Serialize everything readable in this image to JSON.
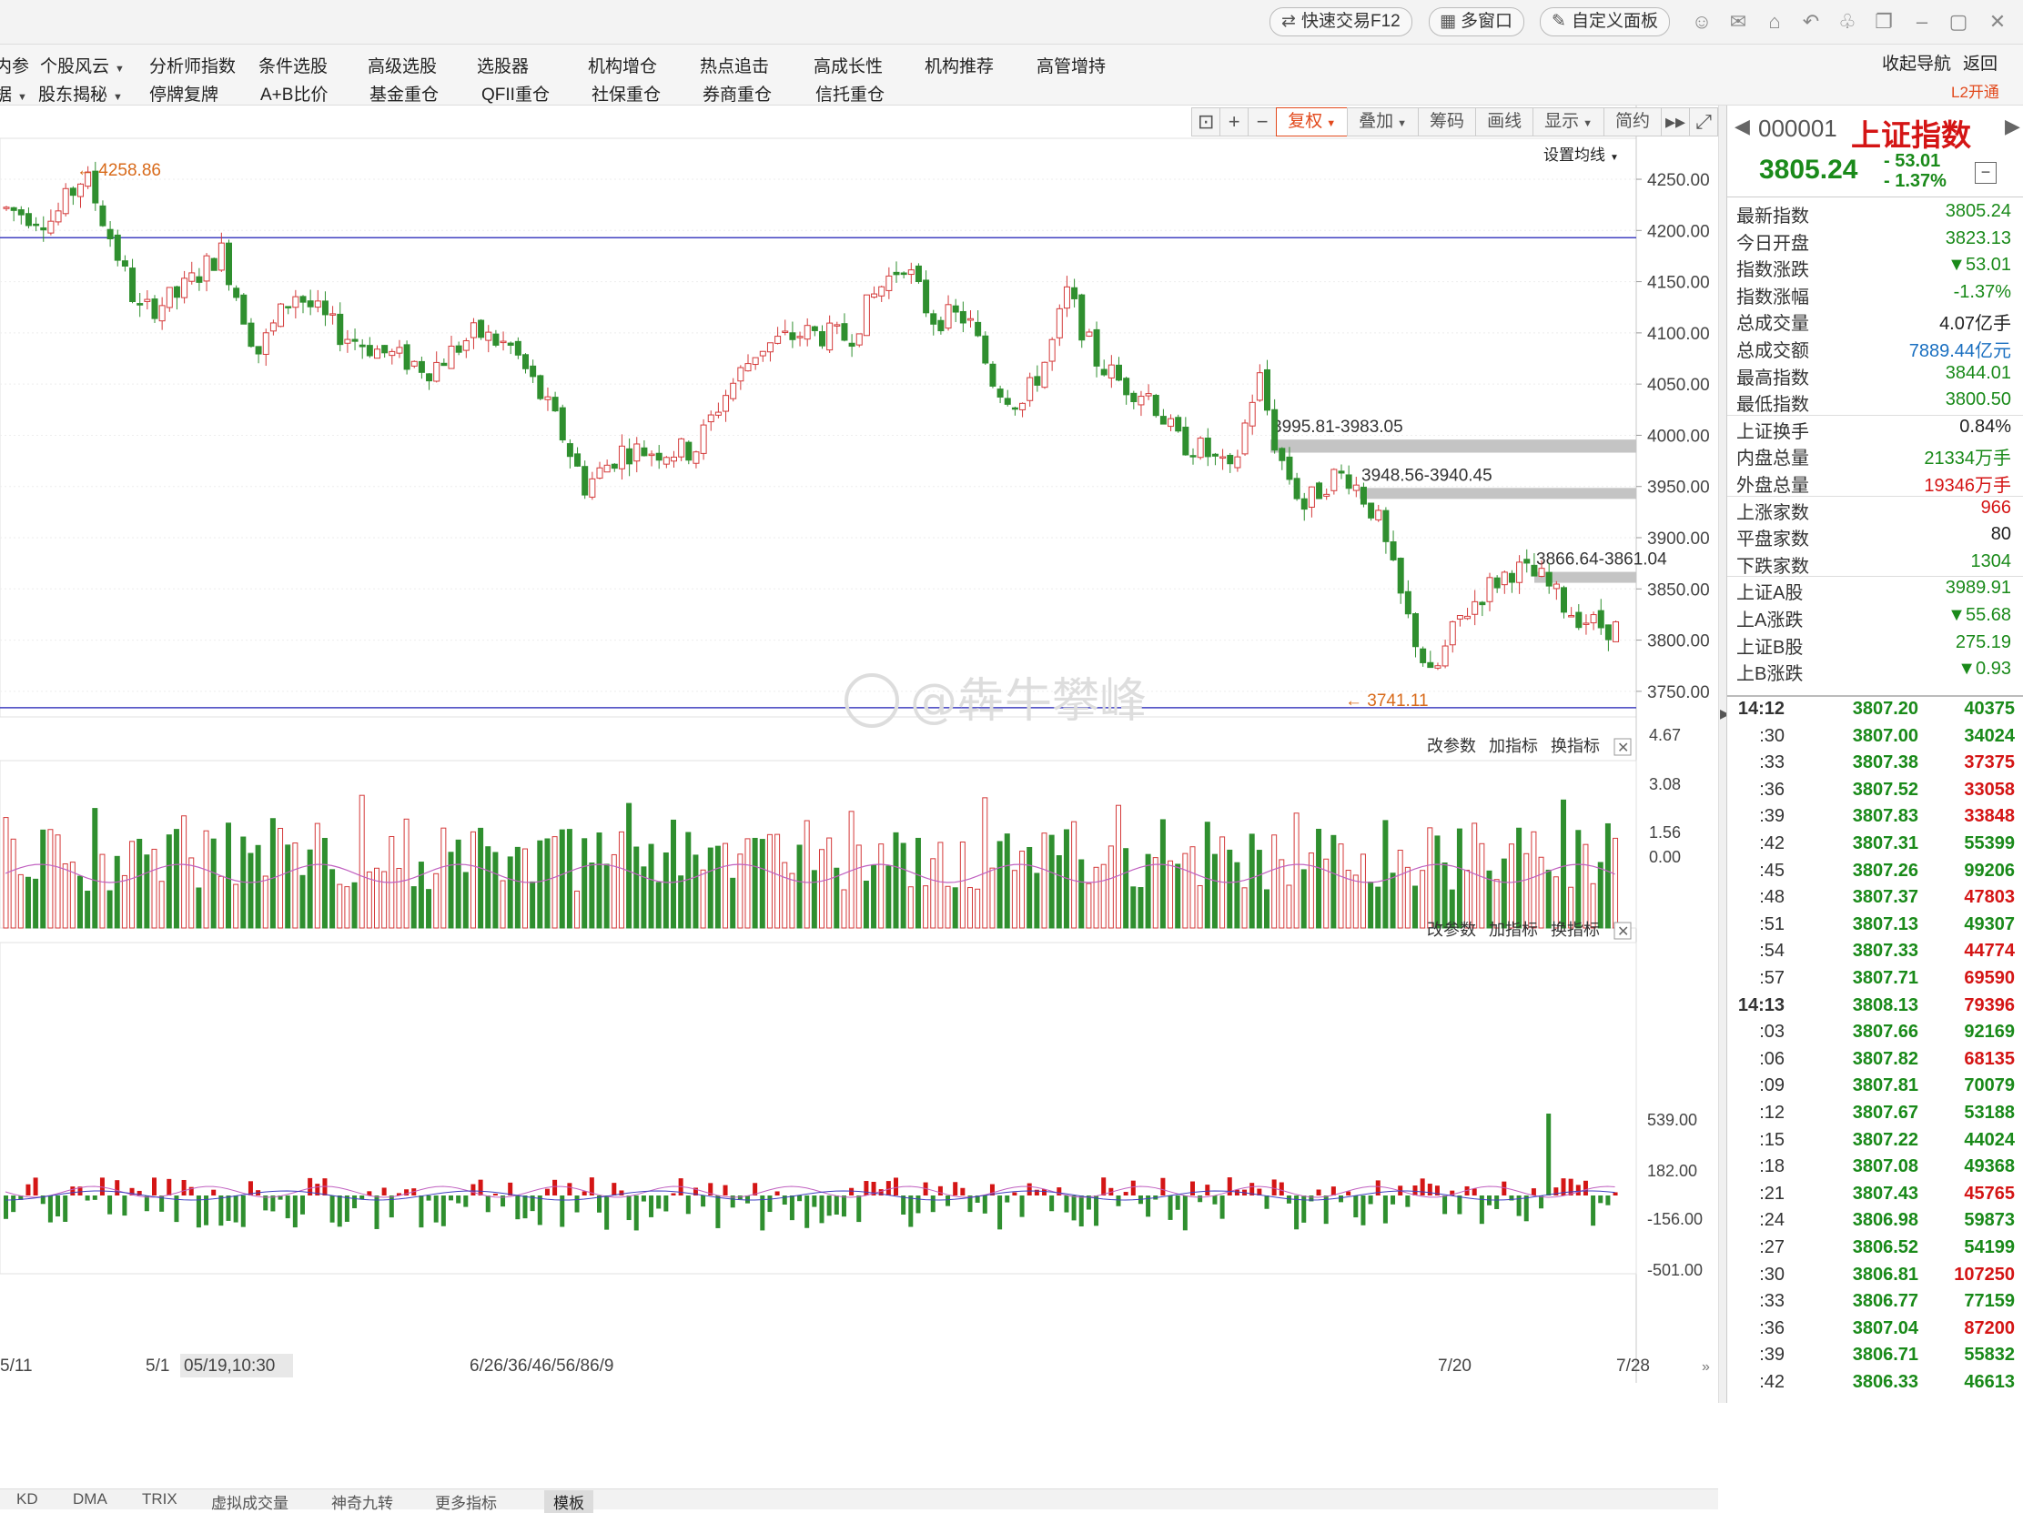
{
  "topbar": {
    "quick_trade": "快速交易F12",
    "multi_window": "多窗口",
    "custom_panel": "自定义面板"
  },
  "menu": {
    "row1": [
      "内参",
      "个股风云",
      "分析师指数",
      "条件选股",
      "高级选股",
      "选股器",
      "机构增仓",
      "热点追击",
      "高成长性",
      "机构推荐",
      "高管增持"
    ],
    "row2": [
      "据",
      "股东揭秘",
      "停牌复牌",
      "A+B比价",
      "基金重仓",
      "QFII重仓",
      "社保重仓",
      "券商重仓",
      "信托重仓"
    ],
    "collapse_nav": "收起导航",
    "back": "返回",
    "l2": "L2开通"
  },
  "toolbar": {
    "fuquan": "复权",
    "overlay": "叠加",
    "chips": "筹码",
    "draw": "画线",
    "display": "显示",
    "simple": "简约"
  },
  "chart": {
    "avg_setting": "设置均线",
    "y_ticks": [
      "4250.00",
      "4200.00",
      "4150.00",
      "4100.00",
      "4050.00",
      "4000.00",
      "3950.00",
      "3900.00",
      "3850.00",
      "3800.00",
      "3750.00"
    ],
    "high_label": "4258.86",
    "low_label": "3741.11",
    "gaps": [
      "3995.81-3983.05",
      "3948.56-3940.45",
      "3866.64-3861.04"
    ],
    "watermark": "@犇牛攀峰",
    "vol_ticks": [
      "4.67",
      "3.08",
      "1.56",
      "0.00"
    ],
    "sub_ticks": [
      "539.00",
      "182.00",
      "-156.00",
      "-501.00"
    ],
    "subpanel_actions": [
      "改参数",
      "加指标",
      "换指标"
    ],
    "x_labels": [
      "5/11",
      "5/1",
      "05/19,10:30",
      "6/26/36/46/56/86/9",
      "7/20",
      "7/28"
    ]
  },
  "chart_data": {
    "type": "candlestick",
    "ylim": [
      3725,
      4290
    ],
    "annotations": {
      "high": 4258.86,
      "low": 3741.11
    },
    "horizontal_lines": [
      4193,
      3734
    ],
    "gaps": [
      [
        3983.05,
        3995.81
      ],
      [
        3940.45,
        3948.56
      ],
      [
        3861.04,
        3866.64
      ]
    ]
  },
  "bottom_tabs": [
    "KD",
    "DMA",
    "TRIX",
    "虚拟成交量",
    "神奇九转",
    "更多指标",
    "模板"
  ],
  "quote": {
    "code": "000001",
    "name": "上证指数",
    "price": "3805.24",
    "change": "- 53.01",
    "change_pct": "- 1.37%",
    "fields": [
      {
        "k": "最新指数",
        "v": "3805.24",
        "c": "#1a8a1a"
      },
      {
        "k": "今日开盘",
        "v": "3823.13",
        "c": "#1a8a1a"
      },
      {
        "k": "指数涨跌",
        "v": "▼53.01",
        "c": "#1a8a1a"
      },
      {
        "k": "指数涨幅",
        "v": "-1.37%",
        "c": "#1a8a1a"
      },
      {
        "k": "总成交量",
        "v": "4.07亿手",
        "c": "#222"
      },
      {
        "k": "总成交额",
        "v": "7889.44亿元",
        "c": "#1a6fc0"
      },
      {
        "k": "最高指数",
        "v": "3844.01",
        "c": "#1a8a1a"
      },
      {
        "k": "最低指数",
        "v": "3800.50",
        "c": "#1a8a1a"
      },
      {
        "k": "上证换手",
        "v": "0.84%",
        "c": "#222"
      },
      {
        "k": "内盘总量",
        "v": "21334万手",
        "c": "#1a8a1a"
      },
      {
        "k": "外盘总量",
        "v": "19346万手",
        "c": "#d41515"
      },
      {
        "k": "上涨家数",
        "v": "966",
        "c": "#d41515"
      },
      {
        "k": "平盘家数",
        "v": "80",
        "c": "#222"
      },
      {
        "k": "下跌家数",
        "v": "1304",
        "c": "#1a8a1a"
      },
      {
        "k": "上证A股",
        "v": "3989.91",
        "c": "#1a8a1a"
      },
      {
        "k": "上A涨跌",
        "v": "▼55.68",
        "c": "#1a8a1a"
      },
      {
        "k": "上证B股",
        "v": "275.19",
        "c": "#1a8a1a"
      },
      {
        "k": "上B涨跌",
        "v": "▼0.93",
        "c": "#1a8a1a"
      }
    ]
  },
  "ticks": [
    {
      "t": "14:12",
      "p": "3807.20",
      "v": "40375",
      "c": "#1a8a1a"
    },
    {
      "t": ":30",
      "p": "3807.00",
      "v": "34024",
      "c": "#1a8a1a"
    },
    {
      "t": ":33",
      "p": "3807.38",
      "v": "37375",
      "c": "#d41515"
    },
    {
      "t": ":36",
      "p": "3807.52",
      "v": "33058",
      "c": "#d41515"
    },
    {
      "t": ":39",
      "p": "3807.83",
      "v": "33848",
      "c": "#d41515"
    },
    {
      "t": ":42",
      "p": "3807.31",
      "v": "55399",
      "c": "#1a8a1a"
    },
    {
      "t": ":45",
      "p": "3807.26",
      "v": "99206",
      "c": "#1a8a1a"
    },
    {
      "t": ":48",
      "p": "3807.37",
      "v": "47803",
      "c": "#d41515"
    },
    {
      "t": ":51",
      "p": "3807.13",
      "v": "49307",
      "c": "#1a8a1a"
    },
    {
      "t": ":54",
      "p": "3807.33",
      "v": "44774",
      "c": "#d41515"
    },
    {
      "t": ":57",
      "p": "3807.71",
      "v": "69590",
      "c": "#d41515"
    },
    {
      "t": "14:13",
      "p": "3808.13",
      "v": "79396",
      "c": "#d41515"
    },
    {
      "t": ":03",
      "p": "3807.66",
      "v": "92169",
      "c": "#1a8a1a"
    },
    {
      "t": ":06",
      "p": "3807.82",
      "v": "68135",
      "c": "#d41515"
    },
    {
      "t": ":09",
      "p": "3807.81",
      "v": "70079",
      "c": "#1a8a1a"
    },
    {
      "t": ":12",
      "p": "3807.67",
      "v": "53188",
      "c": "#1a8a1a"
    },
    {
      "t": ":15",
      "p": "3807.22",
      "v": "44024",
      "c": "#1a8a1a"
    },
    {
      "t": ":18",
      "p": "3807.08",
      "v": "49368",
      "c": "#1a8a1a"
    },
    {
      "t": ":21",
      "p": "3807.43",
      "v": "45765",
      "c": "#d41515"
    },
    {
      "t": ":24",
      "p": "3806.98",
      "v": "59873",
      "c": "#1a8a1a"
    },
    {
      "t": ":27",
      "p": "3806.52",
      "v": "54199",
      "c": "#1a8a1a"
    },
    {
      "t": ":30",
      "p": "3806.81",
      "v": "107250",
      "c": "#d41515"
    },
    {
      "t": ":33",
      "p": "3806.77",
      "v": "77159",
      "c": "#1a8a1a"
    },
    {
      "t": ":36",
      "p": "3807.04",
      "v": "87200",
      "c": "#d41515"
    },
    {
      "t": ":39",
      "p": "3806.71",
      "v": "55832",
      "c": "#1a8a1a"
    },
    {
      "t": ":42",
      "p": "3806.33",
      "v": "46613",
      "c": "#1a8a1a"
    }
  ]
}
